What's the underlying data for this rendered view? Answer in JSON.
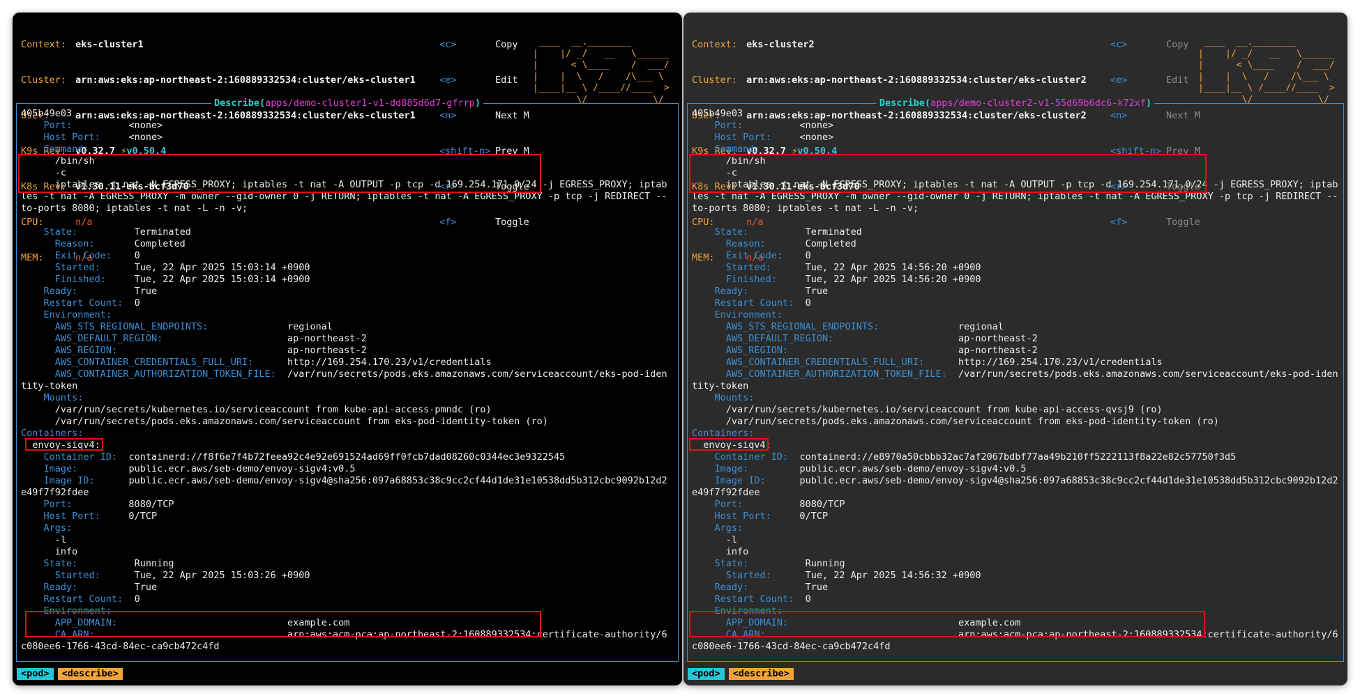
{
  "colors": {
    "header_key": "#f2a33a",
    "field": "#3a8fd6",
    "border": "#3a8fd6",
    "highlight": "#e01212",
    "title_main": "#2ad1d1",
    "title_ref": "#e23dd8"
  },
  "panes": [
    {
      "header": {
        "context": "eks-cluster1",
        "cluster": "arn:aws:eks:ap-northeast-2:160889332534:cluster/eks-cluster1",
        "user": "arn:aws:eks:ap-northeast-2:160889332534:cluster/eks-cluster1",
        "k9s_rev": "v0.32.7",
        "k9s_latest": "v0.50.4",
        "k8s_rev": "v1.30.11-eks-bcf3d70",
        "cpu": "n/a",
        "mem": "n/a"
      },
      "title_kind": "Describe",
      "title_ref": "apps/demo-cluster1-v1-dd885d6d7-gfrrp",
      "lines": [
        "405b49e03",
        "    Port:          <none>",
        "    Host Port:     <none>",
        "    Command:",
        "      /bin/sh",
        "      -c",
        "      iptables -t nat -N EGRESS_PROXY; iptables -t nat -A OUTPUT -p tcp -d 169.254.171.0/24 -j EGRESS_PROXY; iptab",
        "les -t nat -A EGRESS_PROXY -m owner --gid-owner 0 -j RETURN; iptables -t nat -A EGRESS_PROXY -p tcp -j REDIRECT --",
        "to-ports 8080; iptables -t nat -L -n -v;",
        "",
        "    State:          Terminated",
        "      Reason:       Completed",
        "      Exit Code:    0",
        "      Started:      Tue, 22 Apr 2025 15:03:14 +0900",
        "      Finished:     Tue, 22 Apr 2025 15:03:14 +0900",
        "    Ready:          True",
        "    Restart Count:  0",
        "    Environment:",
        "      AWS_STS_REGIONAL_ENDPOINTS:              regional",
        "      AWS_DEFAULT_REGION:                      ap-northeast-2",
        "      AWS_REGION:                              ap-northeast-2",
        "      AWS_CONTAINER_CREDENTIALS_FULL_URI:      http://169.254.170.23/v1/credentials",
        "      AWS_CONTAINER_AUTHORIZATION_TOKEN_FILE:  /var/run/secrets/pods.eks.amazonaws.com/serviceaccount/eks-pod-iden",
        "tity-token",
        "    Mounts:",
        "      /var/run/secrets/kubernetes.io/serviceaccount from kube-api-access-pmndc (ro)",
        "      /var/run/secrets/pods.eks.amazonaws.com/serviceaccount from eks-pod-identity-token (ro)",
        "Containers:",
        "  envoy-sigv4:",
        "    Container ID:  containerd://f8f6e7f4b72feea92c4e92e691524ad69ff0fcb7dad08260c0344ec3e9322545",
        "    Image:         public.ecr.aws/seb-demo/envoy-sigv4:v0.5",
        "    Image ID:      public.ecr.aws/seb-demo/envoy-sigv4@sha256:097a68853c38c9cc2cf44d1de31e10538dd5b312cbc9092b12d2",
        "e49f7f92fdee",
        "    Port:          8080/TCP",
        "    Host Port:     0/TCP",
        "    Args:",
        "      -l",
        "      info",
        "    State:          Running",
        "      Started:      Tue, 22 Apr 2025 15:03:26 +0900",
        "    Ready:          True",
        "    Restart Count:  0",
        "    Environment:",
        "      APP_DOMAIN:                              example.com",
        "      CA_ARN:                                  arn:aws:acm-pca:ap-northeast-2:160889332534:certificate-authority/6",
        "c080ee6-1766-43cd-84ec-ca9cb472c4fd"
      ]
    },
    {
      "header": {
        "context": "eks-cluster2",
        "cluster": "arn:aws:eks:ap-northeast-2:160889332534:cluster/eks-cluster2",
        "user": "arn:aws:eks:ap-northeast-2:160889332534:cluster/eks-cluster2",
        "k9s_rev": "v0.32.7",
        "k9s_latest": "v0.50.4",
        "k8s_rev": "v1.30.11-eks-bcf3d70",
        "cpu": "n/a",
        "mem": "n/a"
      },
      "title_kind": "Describe",
      "title_ref": "apps/demo-cluster2-v1-55d69b6dc6-k72xf",
      "lines": [
        "405b49e03",
        "    Port:          <none>",
        "    Host Port:     <none>",
        "    Command:",
        "      /bin/sh",
        "      -c",
        "      iptables -t nat -N EGRESS_PROXY; iptables -t nat -A OUTPUT -p tcp -d 169.254.171.0/24 -j EGRESS_PROXY; iptab",
        "les -t nat -A EGRESS_PROXY -m owner --gid-owner 0 -j RETURN; iptables -t nat -A EGRESS_PROXY -p tcp -j REDIRECT --",
        "to-ports 8080; iptables -t nat -L -n -v;",
        "",
        "    State:          Terminated",
        "      Reason:       Completed",
        "      Exit Code:    0",
        "      Started:      Tue, 22 Apr 2025 14:56:20 +0900",
        "      Finished:     Tue, 22 Apr 2025 14:56:20 +0900",
        "    Ready:          True",
        "    Restart Count:  0",
        "    Environment:",
        "      AWS_STS_REGIONAL_ENDPOINTS:              regional",
        "      AWS_DEFAULT_REGION:                      ap-northeast-2",
        "      AWS_REGION:                              ap-northeast-2",
        "      AWS_CONTAINER_CREDENTIALS_FULL_URI:      http://169.254.170.23/v1/credentials",
        "      AWS_CONTAINER_AUTHORIZATION_TOKEN_FILE:  /var/run/secrets/pods.eks.amazonaws.com/serviceaccount/eks-pod-iden",
        "tity-token",
        "    Mounts:",
        "      /var/run/secrets/kubernetes.io/serviceaccount from kube-api-access-qvsj9 (ro)",
        "      /var/run/secrets/pods.eks.amazonaws.com/serviceaccount from eks-pod-identity-token (ro)",
        "Containers:",
        "  envoy-sigv4:",
        "    Container ID:  containerd://e8970a50cbbb32ac7af2067bdbf77aa49b210ff5222113f8a22e82c57750f3d5",
        "    Image:         public.ecr.aws/seb-demo/envoy-sigv4:v0.5",
        "    Image ID:      public.ecr.aws/seb-demo/envoy-sigv4@sha256:097a68853c38c9cc2cf44d1de31e10538dd5b312cbc9092b12d2",
        "e49f7f92fdee",
        "    Port:          8080/TCP",
        "    Host Port:     0/TCP",
        "    Args:",
        "      -l",
        "      info",
        "    State:          Running",
        "      Started:      Tue, 22 Apr 2025 14:56:32 +0900",
        "    Ready:          True",
        "    Restart Count:  0",
        "    Environment:",
        "      APP_DOMAIN:                              example.com",
        "      CA_ARN:                                  arn:aws:acm-pca:ap-northeast-2:160889332534:certificate-authority/6",
        "c080ee6-1766-43cd-84ec-ca9cb472c4fd"
      ]
    }
  ],
  "labels": {
    "context": "Context:",
    "cluster": "Cluster:",
    "user": "User:",
    "k9s_rev": "K9s Rev:",
    "k8s_rev": "K8s Rev:",
    "cpu": "CPU:",
    "mem": "MEM:"
  },
  "keys": [
    {
      "key": "<c>",
      "desc": "Copy"
    },
    {
      "key": "<e>",
      "desc": "Edit"
    },
    {
      "key": "<n>",
      "desc": "Next M"
    },
    {
      "key": "<shift-n>",
      "desc": "Prev M"
    },
    {
      "key": "<r>",
      "desc": "Toggle"
    },
    {
      "key": "<f>",
      "desc": "Toggle"
    }
  ],
  "logo_lines": [
    " ____  __.________",
    "|    |/ _/   __   \\______",
    "|      < \\____    /  ___/",
    "|    |  \\   /    /\\___ \\",
    "|____|__ \\ /____//____  >",
    "        \\/            \\/"
  ],
  "breadcrumbs": [
    "<pod>",
    "<describe>"
  ],
  "icons": {
    "flash": "lightning-icon"
  }
}
